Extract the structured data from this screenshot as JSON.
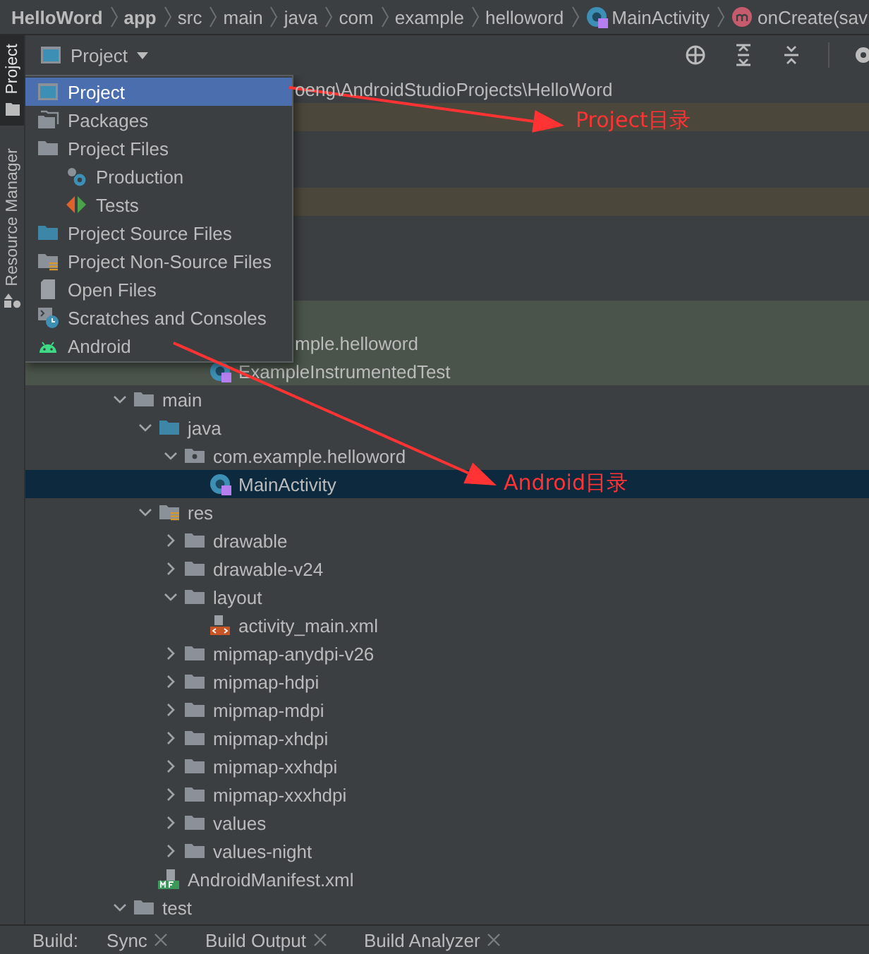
{
  "breadcrumb": [
    {
      "label": "HelloWord",
      "bold": true,
      "kind": "plain"
    },
    {
      "label": "app",
      "bold": true,
      "kind": "plain"
    },
    {
      "label": "src",
      "bold": false,
      "kind": "plain"
    },
    {
      "label": "main",
      "bold": false,
      "kind": "plain"
    },
    {
      "label": "java",
      "bold": false,
      "kind": "plain"
    },
    {
      "label": "com",
      "bold": false,
      "kind": "plain"
    },
    {
      "label": "example",
      "bold": false,
      "kind": "plain"
    },
    {
      "label": "helloword",
      "bold": false,
      "kind": "plain"
    },
    {
      "label": "MainActivity",
      "bold": false,
      "kind": "class"
    },
    {
      "label": "onCreate(sav",
      "bold": false,
      "kind": "method"
    }
  ],
  "side_tabs": [
    {
      "label": "Project",
      "selected": true,
      "kind": "project"
    },
    {
      "label": "Resource Manager",
      "selected": false,
      "kind": "resources"
    }
  ],
  "panel": {
    "view_button": "Project"
  },
  "view_menu": [
    {
      "label": "Project",
      "kind": "project",
      "selected": true
    },
    {
      "label": "Packages",
      "kind": "packages",
      "selected": false
    },
    {
      "label": "Project Files",
      "kind": "folder",
      "selected": false,
      "children": [
        {
          "label": "Production",
          "kind": "production",
          "selected": false
        },
        {
          "label": "Tests",
          "kind": "tests",
          "selected": false
        }
      ]
    },
    {
      "label": "Project Source Files",
      "kind": "source",
      "selected": false
    },
    {
      "label": "Project Non-Source Files",
      "kind": "nonsource",
      "selected": false
    },
    {
      "label": "Open Files",
      "kind": "file",
      "selected": false
    },
    {
      "label": "Scratches and Consoles",
      "kind": "scratch",
      "selected": false
    },
    {
      "label": "Android",
      "kind": "android",
      "selected": false
    }
  ],
  "tree": {
    "partial_rows": [
      {
        "text": "oeng\\AndroidStudioProjects\\HelloWord"
      },
      {
        "color": "#4b473b"
      },
      {},
      {},
      {
        "color": "#4b473b"
      },
      {},
      {},
      {},
      {
        "color": "#4a544a"
      },
      {
        "color": "#4a544a",
        "text": "mple.helloword",
        "children": [
          {
            "label": "ExampleInstrumentedTest",
            "kind": "class",
            "selected": false,
            "color": "#4a544a"
          }
        ]
      }
    ],
    "nodes": [
      {
        "label": "main",
        "kind": "folder",
        "expanded": true,
        "selected": false,
        "children": [
          {
            "label": "java",
            "kind": "source",
            "expanded": true,
            "selected": false,
            "children": [
              {
                "label": "com.example.helloword",
                "kind": "package",
                "expanded": true,
                "selected": false,
                "children": [
                  {
                    "label": "MainActivity",
                    "kind": "class",
                    "selected": true
                  }
                ]
              }
            ]
          },
          {
            "label": "res",
            "kind": "resources",
            "expanded": true,
            "selected": false,
            "children": [
              {
                "label": "drawable",
                "kind": "folder",
                "expanded": false,
                "selected": false
              },
              {
                "label": "drawable-v24",
                "kind": "folder",
                "expanded": false,
                "selected": false
              },
              {
                "label": "layout",
                "kind": "folder",
                "expanded": true,
                "selected": false,
                "children": [
                  {
                    "label": "activity_main.xml",
                    "kind": "xml",
                    "selected": false
                  }
                ]
              },
              {
                "label": "mipmap-anydpi-v26",
                "kind": "folder",
                "expanded": false,
                "selected": false
              },
              {
                "label": "mipmap-hdpi",
                "kind": "folder",
                "expanded": false,
                "selected": false
              },
              {
                "label": "mipmap-mdpi",
                "kind": "folder",
                "expanded": false,
                "selected": false
              },
              {
                "label": "mipmap-xhdpi",
                "kind": "folder",
                "expanded": false,
                "selected": false
              },
              {
                "label": "mipmap-xxhdpi",
                "kind": "folder",
                "expanded": false,
                "selected": false
              },
              {
                "label": "mipmap-xxxhdpi",
                "kind": "folder",
                "expanded": false,
                "selected": false
              },
              {
                "label": "values",
                "kind": "folder",
                "expanded": false,
                "selected": false
              },
              {
                "label": "values-night",
                "kind": "folder",
                "expanded": false,
                "selected": false
              }
            ]
          },
          {
            "label": "AndroidManifest.xml",
            "kind": "manifest",
            "selected": false
          }
        ]
      },
      {
        "label": "test",
        "kind": "folder",
        "expanded": true,
        "selected": false
      }
    ]
  },
  "build_bar": {
    "label": "Build:",
    "tabs": [
      {
        "label": "Sync"
      },
      {
        "label": "Build Output"
      },
      {
        "label": "Build Analyzer"
      }
    ]
  },
  "annotations": [
    {
      "text": "Project目录"
    },
    {
      "text": "Android目录"
    }
  ]
}
